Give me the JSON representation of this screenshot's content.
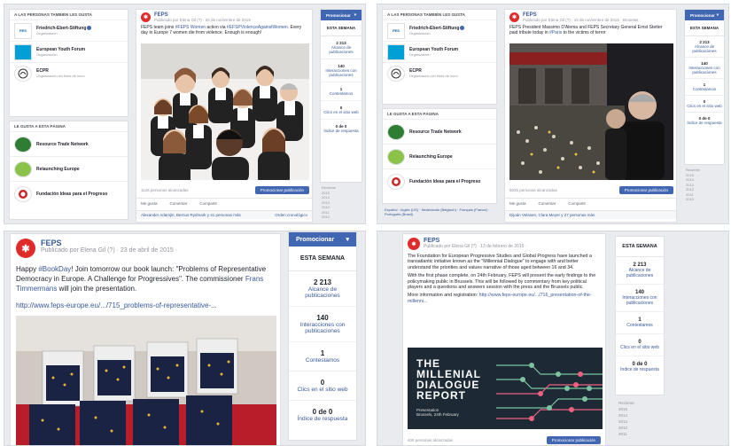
{
  "q1": {
    "side_heading": "A LAS PERSONAS TAMBIÉN LES GUSTA",
    "liked_pages": [
      {
        "name": "Friedrich-Ebert-Stiftung",
        "sub": "Organización",
        "thumb": "FES"
      },
      {
        "name": "European Youth Forum",
        "sub": "Organización",
        "thumb": ""
      },
      {
        "name": "ECPR",
        "sub": "Organización sin fines de lucro",
        "thumb": "ECPR"
      }
    ],
    "likes_heading": "LE GUSTA A ESTA PÁGINA",
    "page_likes": [
      {
        "name": "Resource Trade Network"
      },
      {
        "name": "Relaunching Europe"
      },
      {
        "name": "Fundación Ideas para el Progreso"
      }
    ],
    "post": {
      "page_name": "FEPS",
      "meta": "Publicado por Elena Gil (?) · 25 de noviembre de 2015 ·",
      "text_a": "FEPS team joins ",
      "tag_a": "#FEPS Women",
      "text_b": " action via ",
      "tag_b": "#EFSPViolenceAgainstWomen",
      "text_c": ". Every day in Europe 7 women die from violence. Enough is enough!",
      "reached": "1126 personas alcanzadas",
      "promote": "Promocionar publicación",
      "like": "Me gusta",
      "comment": "Comentar",
      "share": "Compartir",
      "comment_line": "Alexander Adamjin, Bernus Rydmark y 41 personas más",
      "order": "Orden cronológico"
    },
    "stats": {
      "promote": "Promocionar",
      "week": "ESTA SEMANA",
      "items": [
        {
          "num": "2 213",
          "label": "Alcance de publicaciones"
        },
        {
          "num": "140",
          "label": "Interacciones con publicaciones"
        },
        {
          "num": "1",
          "label": "Contestamos"
        },
        {
          "num": "0",
          "label": "Clics en el sitio web"
        },
        {
          "num": "0 de 0",
          "label": "Índice de respuesta"
        }
      ],
      "years_label": "Reciente",
      "years": [
        "2015",
        "2014",
        "2013",
        "2012",
        "2011",
        "2010"
      ]
    }
  },
  "q2": {
    "side_heading": "A LAS PERSONAS TAMBIÉN LES GUSTA",
    "liked_pages": [
      {
        "name": "Friedrich-Ebert-Stiftung",
        "sub": "Organización",
        "thumb": "FES"
      },
      {
        "name": "European Youth Forum",
        "sub": "Organización",
        "thumb": ""
      },
      {
        "name": "ECPR",
        "sub": "Organización sin fines de lucro",
        "thumb": "ECPR"
      }
    ],
    "likes_heading": "LE GUSTA A ESTA PÁGINA",
    "page_likes": [
      {
        "name": "Resource Trade Network"
      },
      {
        "name": "Relaunching Europe"
      },
      {
        "name": "Fundación Ideas para el Progreso"
      }
    ],
    "post": {
      "page_name": "FEPS",
      "meta": "Publicado por Elena Gil (?) · 15 de noviembre de 2015 · Bruselas ·",
      "text_a": "FEPS President Massimo D'Alema and FEPS Secretary General Ernst Stetter paid tribute today in ",
      "tag_a": "#Paris",
      "text_b": " to the victims of terror",
      "reached": "5025 personas alcanzadas",
      "promote": "Promocionar publicación",
      "like": "Me gusta",
      "comment": "Comentar",
      "share": "Compartir",
      "comment_line": "Dijoán Velasen, Clara Meyer y 27 personas más"
    },
    "footer_lang": "Español · Inglés (US) · Nederlands (Belgisch) · Français (France) · Português (Brasil)",
    "stats": {
      "promote": "Promocionar",
      "week": "ESTA SEMANA",
      "items": [
        {
          "num": "2 213",
          "label": "Alcance de publicaciones"
        },
        {
          "num": "140",
          "label": "Interacciones con publicaciones"
        },
        {
          "num": "1",
          "label": "Contestamos"
        },
        {
          "num": "0",
          "label": "Clics en el sitio web"
        },
        {
          "num": "0 de 0",
          "label": "Índice de respuesta"
        }
      ],
      "years_label": "Reciente",
      "years": [
        "2015",
        "2014",
        "2013",
        "2012",
        "2011",
        "2010"
      ]
    }
  },
  "q3": {
    "post": {
      "page_name": "FEPS",
      "meta": "Publicado por Elena Gil (?) · 23 de abril de 2015 ·",
      "text_a": "Happy ",
      "tag_a": "#BookDay",
      "text_b": "! Join tomorrow our book launch: \"Problems of Representative Democracy in Europe. A Challenge for Progressives\". The commissioner ",
      "tag_b": "Frans Timmermans",
      "text_c": " will join the presentation.",
      "link": "http://www.feps-europe.eu/.../715_problems-of-representative-..."
    },
    "stats": {
      "promote": "Promocionar",
      "week": "ESTA SEMANA",
      "items": [
        {
          "num": "2 213",
          "label": "Alcance de publicaciones"
        },
        {
          "num": "140",
          "label": "Interacciones con publicaciones"
        },
        {
          "num": "1",
          "label": "Contestamos"
        },
        {
          "num": "0",
          "label": "Clics en el sitio web"
        },
        {
          "num": "0 de 0",
          "label": "Índice de respuesta"
        }
      ]
    }
  },
  "q4": {
    "post": {
      "page_name": "FEPS",
      "meta": "Publicado por Elena Gil (?) · 13 de febrero de 2015 ·",
      "p1": "The Foundation for European Progressive Studies and Global Progress have launched a transatlantic initiative known as the \"Millennial Dialogue\" to engage with and better understand the priorities and values narrative of those aged between 16 and 34.",
      "p2": "With the first phase complete, on 24th February, FEPS will present the early findings to the policymaking public in Brussels. This will be followed by commentary from key political players and a questions and answers session with the press and the Brussels public.",
      "p3_a": "More information and registration: ",
      "p3_link": "http://www.feps-europe.eu/.../716_presentation-of-the-millenni...",
      "report_title": "THE MILLENIAL DIALOGUE REPORT",
      "report_l1": "THE",
      "report_l2": "MILLENIAL",
      "report_l3": "DIALOGUE",
      "report_l4": "REPORT",
      "report_sub1": "Presentation",
      "report_sub2": "Brussels, 24th February",
      "reached": "406 personas alcanzadas",
      "promote": "Promocionar publicación"
    },
    "stats": {
      "week": "ESTA SEMANA",
      "items": [
        {
          "num": "2 213",
          "label": "Alcance de publicaciones"
        },
        {
          "num": "140",
          "label": "Interacciones con publicaciones"
        },
        {
          "num": "1",
          "label": "Contestamos"
        },
        {
          "num": "0",
          "label": "Clics en el sitio web"
        },
        {
          "num": "0 de 0",
          "label": "Índice de respuesta"
        }
      ],
      "years_label": "Reciente",
      "years": [
        "2015",
        "2014",
        "2013",
        "2012",
        "2011"
      ]
    }
  }
}
